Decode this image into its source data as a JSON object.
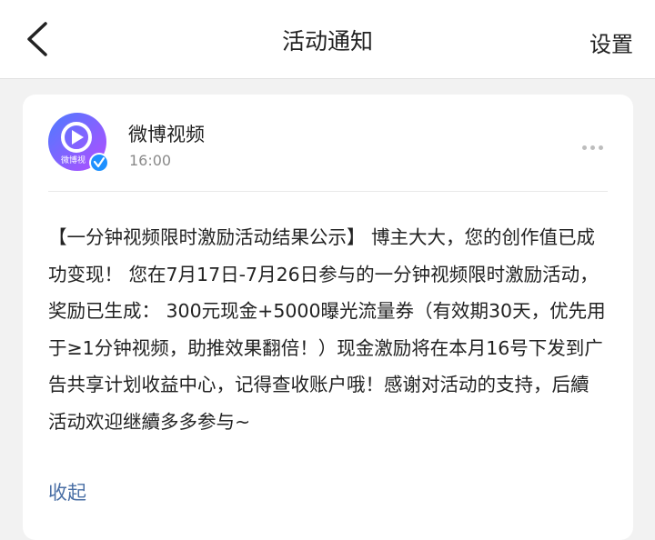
{
  "header": {
    "title": "活动通知",
    "settings_label": "设置"
  },
  "post": {
    "author": "微博视频",
    "time": "16:00",
    "avatar_text": "微博视",
    "content": "【一分钟视频限时激励活动结果公示】  博主大大，您的创作值已成功变现！  您在7月17日-7月26日参与的一分钟视频限时激励活动，奖励已生成：  300元现金+5000曝光流量券（有效期30天，优先用于≥1分钟视频，助推效果翻倍！）现金激励将在本月16号下发到广告共享计划收益中心，记得查收账户哦！感谢对活动的支持，后續活动欢迎继續多多参与~",
    "collapse_label": "收起"
  },
  "colors": {
    "link": "#4a6fa5",
    "avatar_gradient": [
      "#5b6cff",
      "#b44dff"
    ],
    "verified_badge": "#1e90ff"
  }
}
